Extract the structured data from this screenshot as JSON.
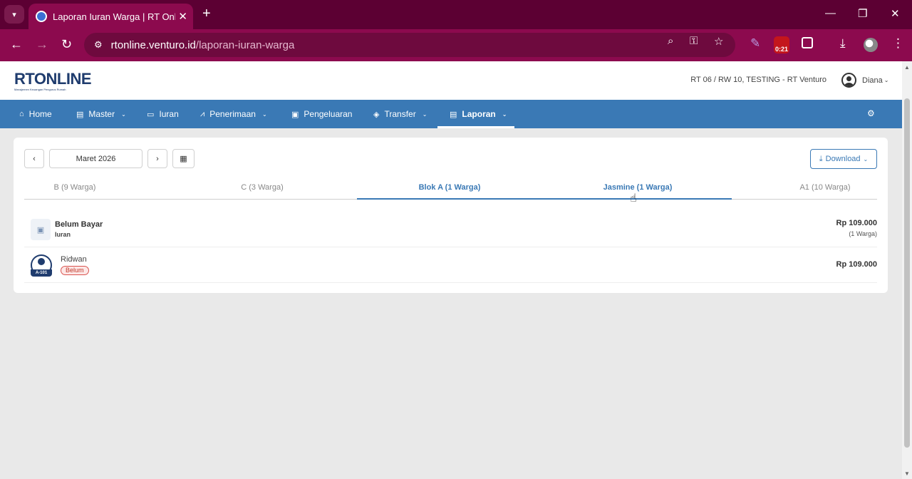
{
  "browser": {
    "tab_title": "Laporan Iuran Warga | RT Online",
    "url_host": "rtonline.venturo.id",
    "url_path": "/laporan-iuran-warga",
    "ext_badge": "0:21",
    "accent_color": "#8c0a4e"
  },
  "header": {
    "logo_text": "RTONLINE",
    "logo_subtitle": "Manajemen Keuangan Pengurus Rumah",
    "org": "RT 06 / RW 10, TESTING - RT Venturo",
    "user_name": "Diana"
  },
  "nav": {
    "items": [
      {
        "label": "Home",
        "icon": "home-icon"
      },
      {
        "label": "Master",
        "icon": "file-icon"
      },
      {
        "label": "Iuran",
        "icon": "card-icon"
      },
      {
        "label": "Penerimaan",
        "icon": "chart-icon"
      },
      {
        "label": "Pengeluaran",
        "icon": "receipt-icon"
      },
      {
        "label": "Transfer",
        "icon": "tag-icon"
      },
      {
        "label": "Laporan",
        "icon": "file-icon"
      }
    ],
    "accent_color": "#3a79b5"
  },
  "filter": {
    "prev": "‹",
    "next": "›",
    "period": "Maret 2026",
    "download_label": "Download"
  },
  "tabs": [
    {
      "label": "B (9 Warga)"
    },
    {
      "label": "C (3 Warga)"
    },
    {
      "label": "Blok A (1 Warga)"
    },
    {
      "label": "Jasmine (1 Warga)"
    },
    {
      "label": "A1 (10 Warga)"
    }
  ],
  "summary": {
    "title": "Belum Bayar",
    "subtitle": "Iuran",
    "amount": "Rp 109.000",
    "count": "(1 Warga)"
  },
  "residents": [
    {
      "unit": "A-101",
      "name": "Ridwan",
      "status": "Belum",
      "amount": "Rp 109.000"
    }
  ]
}
